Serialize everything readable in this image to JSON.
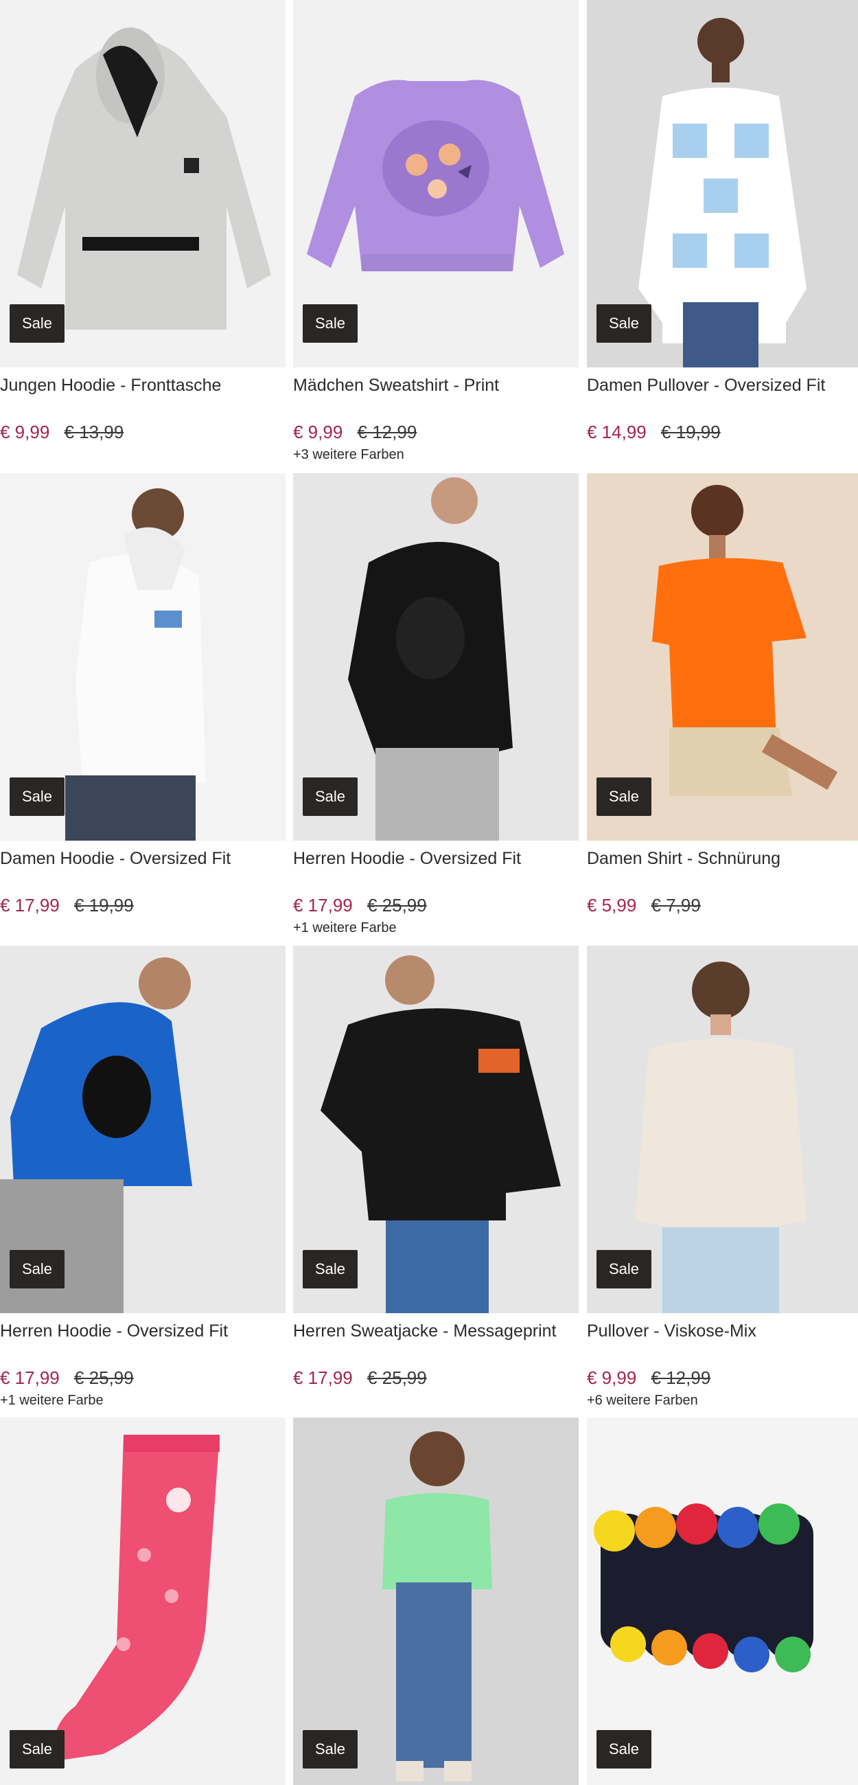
{
  "sale_label": "Sale",
  "products": [
    {
      "title": "Jungen Hoodie - Fronttasche",
      "price": "€ 9,99",
      "old_price": "€ 13,99",
      "colors": "",
      "bg": "#f2f2f2"
    },
    {
      "title": "Mädchen Sweatshirt - Print",
      "price": "€ 9,99",
      "old_price": "€ 12,99",
      "colors": "+3 weitere Farben",
      "bg": "#f1f1f1"
    },
    {
      "title": "Damen Pullover - Oversized Fit",
      "price": "€ 14,99",
      "old_price": "€ 19,99",
      "colors": "",
      "bg": "#d9d9d9"
    },
    {
      "title": "Damen Hoodie - Oversized Fit",
      "price": "€ 17,99",
      "old_price": "€ 19,99",
      "colors": "",
      "bg": "#f3f3f3"
    },
    {
      "title": "Herren Hoodie - Oversized Fit",
      "price": "€ 17,99",
      "old_price": "€ 25,99",
      "colors": "+1 weitere Farbe",
      "bg": "#e6e6e6"
    },
    {
      "title": "Damen Shirt - Schnürung",
      "price": "€ 5,99",
      "old_price": "€ 7,99",
      "colors": "",
      "bg": "#ead9c6"
    },
    {
      "title": "Herren Hoodie - Oversized Fit",
      "price": "€ 17,99",
      "old_price": "€ 25,99",
      "colors": "+1 weitere Farbe",
      "bg": "#e8e8e8"
    },
    {
      "title": "Herren Sweatjacke - Messageprint",
      "price": "€ 17,99",
      "old_price": "€ 25,99",
      "colors": "",
      "bg": "#e6e6e6"
    },
    {
      "title": "Pullover - Viskose-Mix",
      "price": "€ 9,99",
      "old_price": "€ 12,99",
      "colors": "+6 weitere Farben",
      "bg": "#e3e3e3"
    },
    {
      "title": "",
      "price": "",
      "old_price": "",
      "colors": "",
      "bg": "#f2f2f2"
    },
    {
      "title": "",
      "price": "",
      "old_price": "",
      "colors": "",
      "bg": "#d6d6d6"
    },
    {
      "title": "",
      "price": "",
      "old_price": "",
      "colors": "",
      "bg": "#f4f4f4"
    }
  ],
  "colors": {
    "sale_badge_bg": "#2a2624",
    "price_current": "#a3264b",
    "price_old": "#3a3a3a",
    "text": "#2b2b2b"
  }
}
